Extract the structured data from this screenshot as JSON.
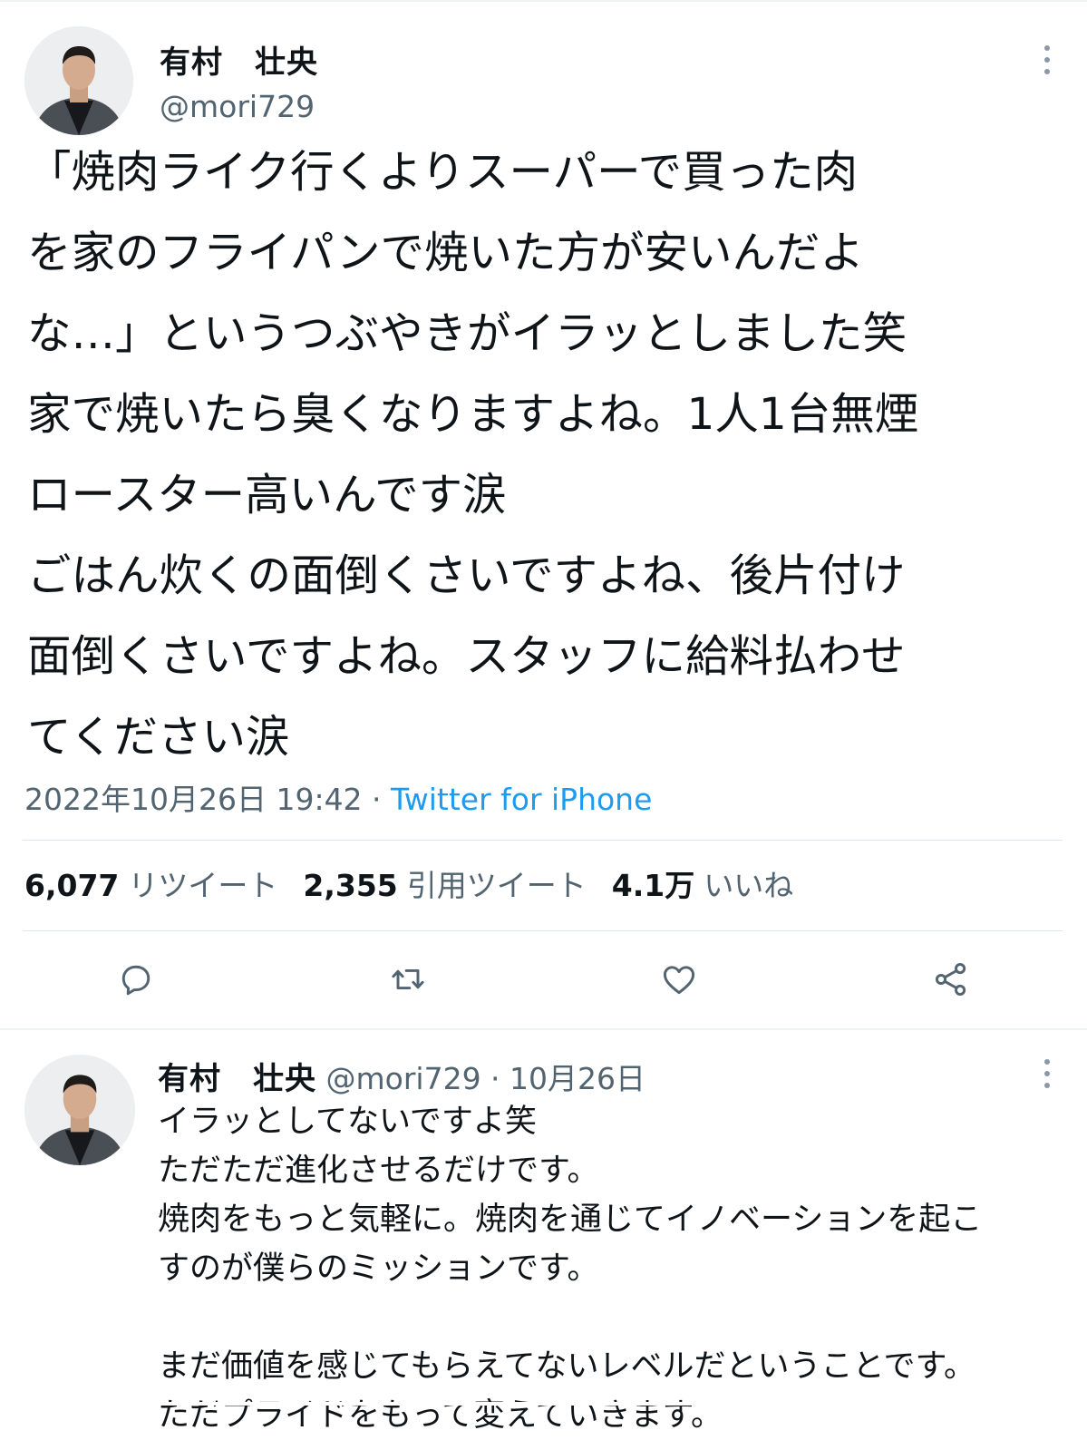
{
  "main_tweet": {
    "author": {
      "name": "有村　壮央",
      "handle": "@mori729"
    },
    "text": "「焼肉ライク行くよりスーパーで買った肉\nを家のフライパンで焼いた方が安いんだよ\nな…」というつぶやきがイラッとしました笑\n家で焼いたら臭くなりますよね。1人1台無煙\nロースター高いんです涙\nごはん炊くの面倒くさいですよね、後片付け\n面倒くさいですよね。スタッフに給料払わせ\nてください涙",
    "timestamp": "2022年10月26日 19:42",
    "separator": " · ",
    "source": "Twitter for iPhone",
    "stats": {
      "retweets": {
        "count": "6,077",
        "label": "リツイート"
      },
      "quotes": {
        "count": "2,355",
        "label": "引用ツイート"
      },
      "likes": {
        "count": "4.1万",
        "label": "いいね"
      }
    },
    "actions": [
      "reply-icon",
      "retweet-icon",
      "heart-icon",
      "share-icon"
    ]
  },
  "reply_tweet": {
    "author": {
      "name": "有村　壮央",
      "handle": "@mori729"
    },
    "separator": " · ",
    "date": "10月26日",
    "text": "イラッとしてないですよ笑\nただただ進化させるだけです。\n焼肉をもっと気軽に。焼肉を通じてイノベーションを起こ\nすのが僕らのミッションです。\n\nまだ価値を感じてもらえてないレベルだということです。\nただプライドをもって変えていきます。"
  },
  "colors": {
    "text": "#0f1419",
    "secondary": "#536471",
    "link": "#1d9bf0",
    "border": "#e1e8ed"
  }
}
